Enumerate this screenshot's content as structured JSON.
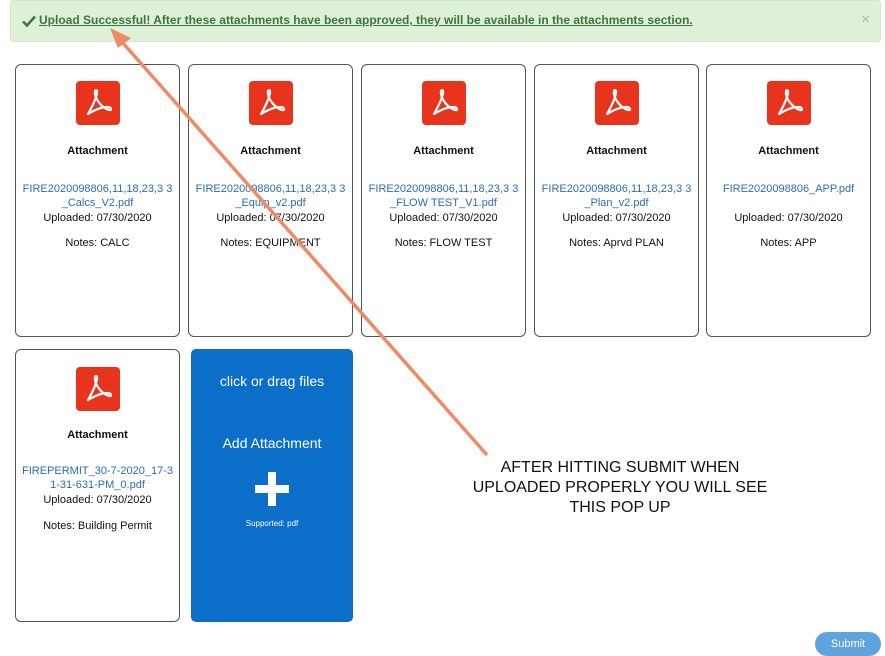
{
  "alert": {
    "message": "Upload Successful! After these attachments have been approved, they will be available in the attachments section.",
    "close_label": "×",
    "color": "#3c763d"
  },
  "attachments": [
    {
      "title": "Attachment",
      "file": "FIRE2020098806,11,18,23,3 3_Calcs_V2.pdf",
      "uploaded": "Uploaded: 07/30/2020",
      "notes": "Notes: CALC"
    },
    {
      "title": "Attachment",
      "file": "FIRE2020098806,11,18,23,3 3_Equip_v2.pdf",
      "uploaded": "Uploaded: 07/30/2020",
      "notes": "Notes: EQUIPMENT"
    },
    {
      "title": "Attachment",
      "file": "FIRE2020098806,11,18,23,3 3_FLOW TEST_V1.pdf",
      "uploaded": "Uploaded: 07/30/2020",
      "notes": "Notes: FLOW TEST"
    },
    {
      "title": "Attachment",
      "file": "FIRE2020098806,11,18,23,3 3_Plan_v2.pdf",
      "uploaded": "Uploaded: 07/30/2020",
      "notes": "Notes: Aprvd PLAN"
    },
    {
      "title": "Attachment",
      "file": "FIRE2020098806_APP.pdf",
      "uploaded": "Uploaded: 07/30/2020",
      "notes": "Notes: APP"
    },
    {
      "title": "Attachment",
      "file": "FIREPERMIT_30-7-2020_17-31-31-631-PM_0.pdf",
      "uploaded": "Uploaded: 07/30/2020",
      "notes": "Notes: Building Permit"
    }
  ],
  "add_card": {
    "drag_text": "click or drag files",
    "add_text": "Add Attachment",
    "supported": "Supported: pdf",
    "color": "#0b6fc9"
  },
  "callout": {
    "text": "AFTER HITTING SUBMIT WHEN UPLOADED PROPERLY YOU WILL SEE THIS POP UP",
    "arrow_color": "#f08a66"
  },
  "submit": {
    "label": "Submit"
  },
  "icons": {
    "pdf": "pdf-icon",
    "check": "check-icon",
    "plus": "plus-icon",
    "close": "close-icon"
  }
}
